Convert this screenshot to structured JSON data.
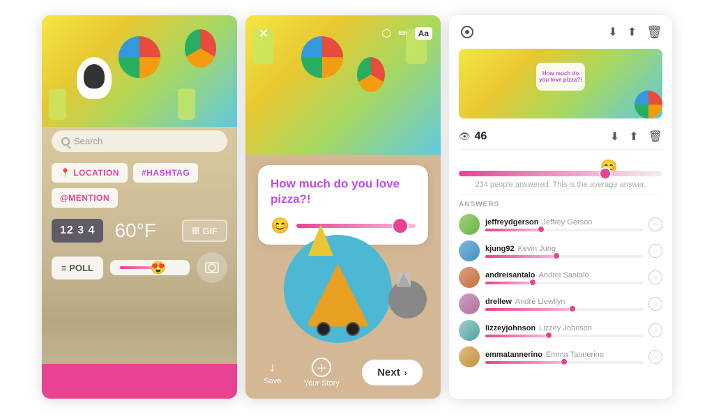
{
  "panel1": {
    "search_placeholder": "Search",
    "tag_location": "📍 LOCATION",
    "tag_hashtag": "#HASHTAG",
    "tag_mention": "@MENTION",
    "time_display": "12 3 4",
    "temp_display": "60°F",
    "gif_label": "GIF",
    "poll_label": "≡ POLL",
    "camera_label": ""
  },
  "panel2": {
    "question": "How much do you love pizza?!",
    "close_icon": "✕",
    "toolbar_icons": [
      "⬡",
      "✏",
      "Aa"
    ],
    "save_label": "Save",
    "your_story_label": "Your Story",
    "next_label": "Next"
  },
  "panel3": {
    "view_count": "46",
    "answers_label": "ANSWERS",
    "avg_text": "234 people answered. This is the average answer.",
    "answers": [
      {
        "username": "jeffreydgerson",
        "display": "Jeffrey Gerson",
        "fill_pct": 35
      },
      {
        "username": "kjung92",
        "display": "Kevin Jung",
        "fill_pct": 45
      },
      {
        "username": "andreisantalo",
        "display": "Andrei Santalo",
        "fill_pct": 30
      },
      {
        "username": "drellew",
        "display": "André Llewllyn",
        "fill_pct": 55
      },
      {
        "username": "lizzeyjohnson",
        "display": "Lizzey Johnson",
        "fill_pct": 40
      },
      {
        "username": "emmatannerino",
        "display": "Emma Tannerino",
        "fill_pct": 50
      }
    ],
    "thumb_text": "How much do you love pizza?!"
  }
}
